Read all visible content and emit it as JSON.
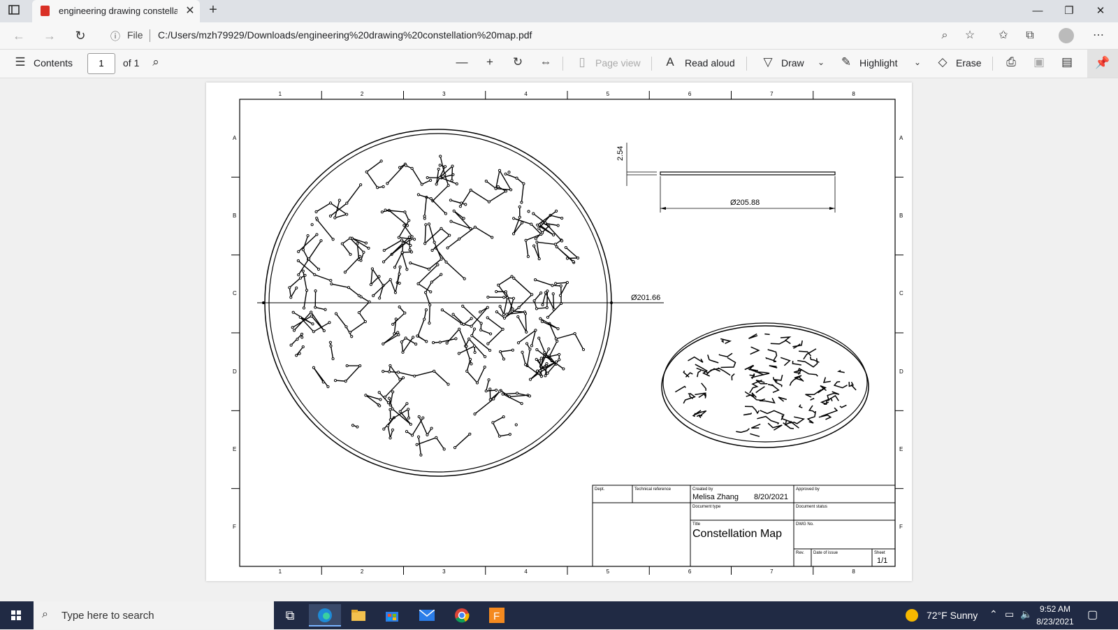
{
  "tab": {
    "title": "engineering drawing constellatic"
  },
  "address": {
    "scheme": "File",
    "url": "C:/Users/mzh79929/Downloads/engineering%20drawing%20constellation%20map.pdf"
  },
  "toolbar": {
    "contents": "Contents",
    "page_current": "1",
    "page_total": "of 1",
    "page_view": "Page view",
    "read_aloud": "Read aloud",
    "draw": "Draw",
    "highlight": "Highlight",
    "erase": "Erase"
  },
  "drawing": {
    "col_labels": [
      "1",
      "2",
      "3",
      "4",
      "5",
      "6",
      "7",
      "8"
    ],
    "row_labels": [
      "A",
      "B",
      "C",
      "D",
      "E",
      "F"
    ],
    "dim_thickness": "2.54",
    "dim_top_diameter": "Ø205.88",
    "dim_diameter": "Ø201.66",
    "title_block": {
      "dept_label": "Dept.",
      "tech_ref_label": "Technical reference",
      "created_by_label": "Created by",
      "created_by": "Melisa Zhang",
      "created_date": "8/20/2021",
      "approved_by_label": "Approved by",
      "doc_type_label": "Document type",
      "doc_status_label": "Document status",
      "title_label": "Title",
      "title": "Constellation Map",
      "dwg_label": "DWG No.",
      "rev_label": "Rev.",
      "date_issue_label": "Date of issue",
      "sheet_label": "Sheet",
      "sheet": "1/1"
    }
  },
  "taskbar": {
    "search_placeholder": "Type here to search",
    "weather": "72°F  Sunny",
    "time": "9:52 AM",
    "date": "8/23/2021"
  }
}
